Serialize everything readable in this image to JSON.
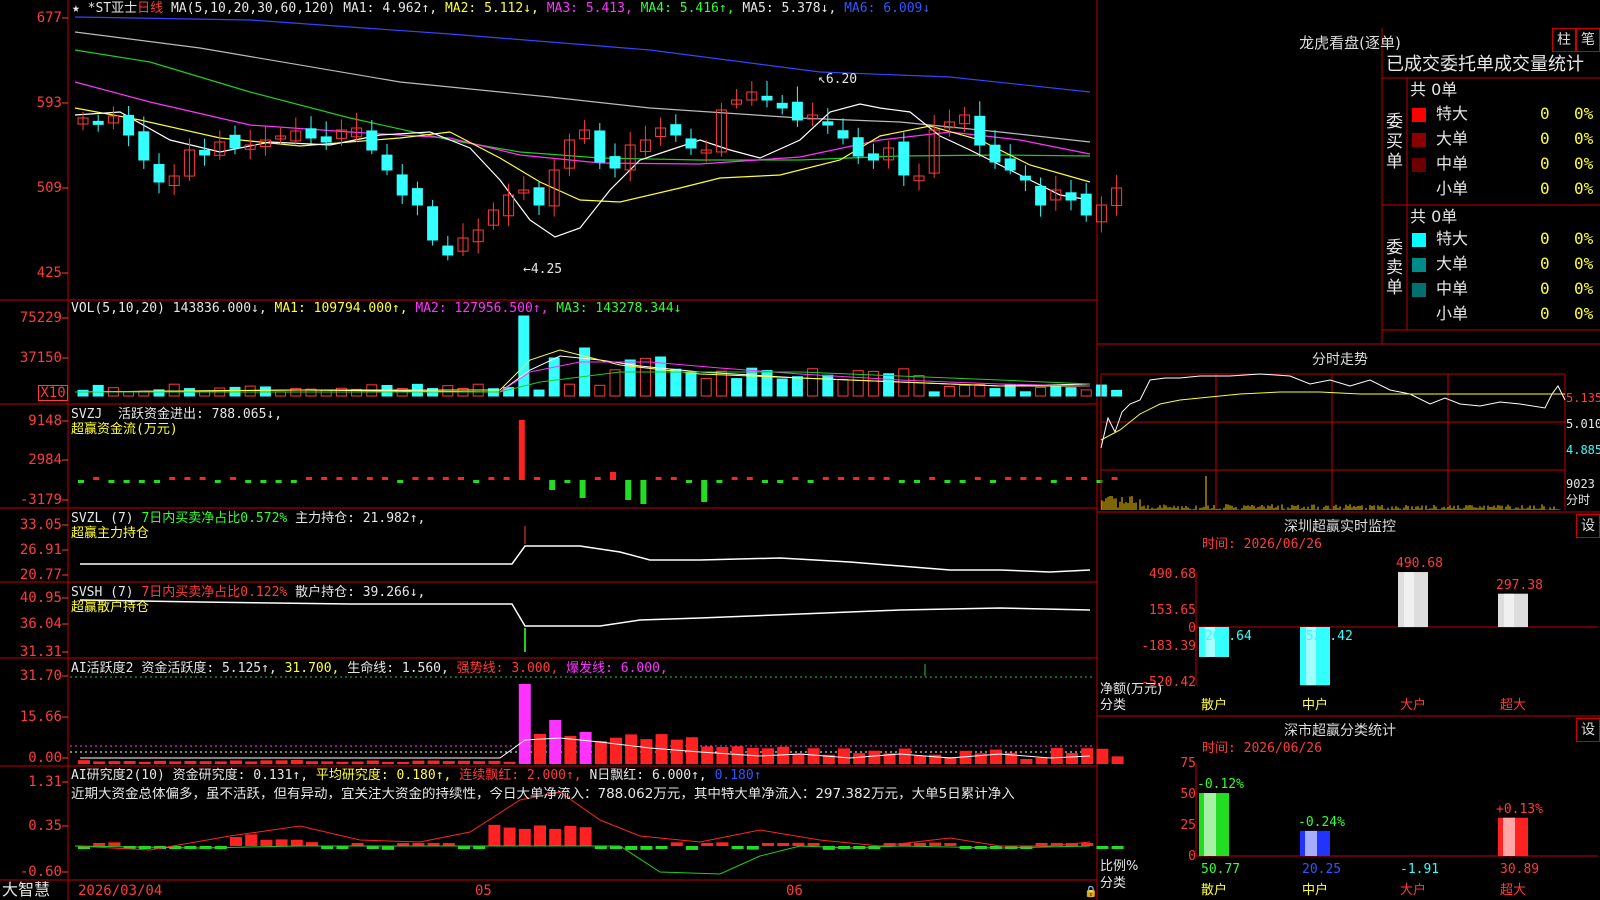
{
  "stock": {
    "star": "★",
    "title": "*ST亚士",
    "period": "日线",
    "ma_params": "MA(5,10,20,30,60,120)",
    "ma1": "MA1: 4.962↑,",
    "ma2": "MA2: 5.112↓,",
    "ma3": "MA3: 5.413,",
    "ma4": "MA4: 5.416↑,",
    "ma5": "MA5: 5.378↓,",
    "ma6": "MA6: 6.009↓",
    "high_mark": "6.20",
    "low_mark": "4.25"
  },
  "axes": {
    "price": [
      "677",
      "593",
      "509",
      "425"
    ],
    "vol": [
      "75229",
      "37150",
      "X10"
    ],
    "svzj": [
      "9148",
      "2984",
      "-3179"
    ],
    "svzl": [
      "33.05",
      "26.91",
      "20.77"
    ],
    "svsh": [
      "40.95",
      "36.04",
      "31.31"
    ],
    "ai": [
      "31.70",
      "15.66",
      "0.00"
    ],
    "ai2": [
      "1.31",
      "0.35",
      "-0.60"
    ]
  },
  "vol_header": {
    "params": "VOL(5,10,20)",
    "vol": "143836.000↓,",
    "ma1": "MA1: 109794.000↑,",
    "ma2": "MA2: 127956.500↑,",
    "ma3": "MA3: 143278.344↓"
  },
  "svzj_header": {
    "name": "SVZJ",
    "text": "活跃资金进出: 788.065↓,",
    "sub": "超赢资金流(万元)"
  },
  "svzl_header": {
    "name": "SVZL (7)",
    "text1": "7日内买卖净占比0.572%",
    "text2": "主力持仓: 21.982↑,",
    "sub": "超赢主力持仓"
  },
  "svsh_header": {
    "name": "SVSH (7)",
    "text1": "7日内买卖净占比0.122%",
    "text2": "散户持仓: 39.266↓,",
    "sub": "超赢散户持仓"
  },
  "ai_header": {
    "name": "AI活跃度2",
    "t1": "资金活跃度: 5.125↑,",
    "t2": "31.700,",
    "t3": "生命线: 1.560,",
    "t4": "强势线: 3.000,",
    "t5": "爆发线: 6.000,"
  },
  "ai2_header": {
    "name": "AI研究度2(10)",
    "t1": "资金研究度: 0.131↑,",
    "t2": "平均研究度: 0.180↑,",
    "t3": "连续飘红: 2.000↑,",
    "t4": "N日飘红: 6.000↑,",
    "t5": "0.180↑"
  },
  "commentary": "近期大资金总体偏多，虽不活跃，但有异动，宜关注大资金的持续性，今日大单净流入：788.062万元，其中特大单净流入：297.382万元，大单5日累计净入",
  "bottom": {
    "brand": "大智慧",
    "date": "2026/03/04",
    "m05": "05",
    "m06": "06"
  },
  "lhkp": {
    "title": "龙虎看盘(逐单)",
    "btn1": "柱",
    "btn2": "笔",
    "subtitle": "已成交委托单成交量统计",
    "buy_label": "委买单",
    "sell_label": "委卖单",
    "buy_total": "共 0单",
    "sell_total": "共 0单",
    "buy_rows": [
      {
        "name": "特大",
        "val": "0",
        "pct": "0%",
        "color": "#ff0000"
      },
      {
        "name": "大单",
        "val": "0",
        "pct": "0%",
        "color": "#8b0000"
      },
      {
        "name": "中单",
        "val": "0",
        "pct": "0%",
        "color": "#6b0000"
      },
      {
        "name": "小单",
        "val": "0",
        "pct": "0%",
        "color": ""
      }
    ],
    "sell_rows": [
      {
        "name": "特大",
        "val": "0",
        "pct": "0%",
        "color": "#00ffff"
      },
      {
        "name": "大单",
        "val": "0",
        "pct": "0%",
        "color": "#008b8b"
      },
      {
        "name": "中单",
        "val": "0",
        "pct": "0%",
        "color": "#007070"
      },
      {
        "name": "小单",
        "val": "0",
        "pct": "0%",
        "color": ""
      }
    ]
  },
  "fenshi": {
    "title": "分时走势",
    "y1": "5.135",
    "y2": "5.010",
    "y3": "4.885",
    "vol": "9023",
    "vol_label": "分时"
  },
  "sz_monitor": {
    "title": "深圳超赢实时监控",
    "btn": "设",
    "time": "时间: 2026/06/26",
    "y": [
      "490.68",
      "153.65",
      "0",
      "-183.39",
      "-520.42"
    ],
    "axis_label1": "净额(万元)",
    "axis_label2": "分类",
    "cats": [
      "散户",
      "中户",
      "大户",
      "超大"
    ],
    "values": [
      -267.64,
      -520.42,
      490.68,
      297.38
    ],
    "value_labels": [
      "-267.64",
      "-520.42",
      "490.68",
      "297.38"
    ]
  },
  "sz_class": {
    "title": "深市超赢分类统计",
    "btn": "设",
    "time": "时间: 2026/06/26",
    "y": [
      "75",
      "50",
      "25",
      "0"
    ],
    "axis_label1": "比例%",
    "axis_label2": "分类",
    "cats": [
      "散户",
      "中户",
      "大户",
      "超大"
    ],
    "values": [
      50.77,
      20.25,
      -1.91,
      30.89
    ],
    "value_labels": [
      "50.77",
      "20.25",
      "-1.91",
      "30.89"
    ],
    "change_labels": [
      "-0.12%",
      "-0.24%",
      "",
      "+0.13%"
    ]
  }
}
